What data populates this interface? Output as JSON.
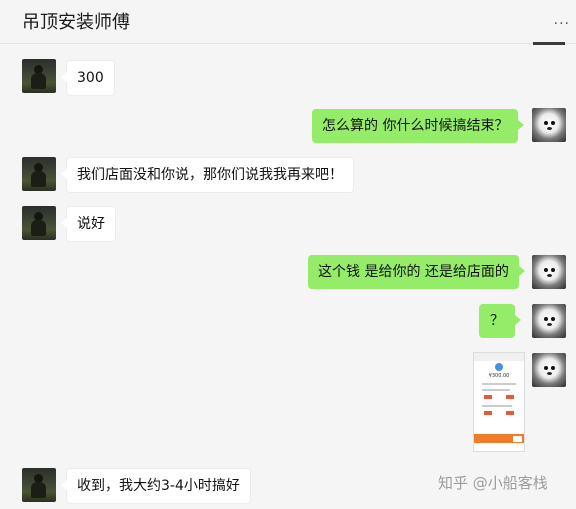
{
  "header": {
    "title": "吊顶安装师傅",
    "more": "..."
  },
  "messages": [
    {
      "side": "left",
      "text": "300"
    },
    {
      "side": "right",
      "text": "怎么算的  你什么时候搞结束？"
    },
    {
      "side": "left",
      "text": "我们店面没和你说，那你们说我我再来吧！"
    },
    {
      "side": "left",
      "text": "说好"
    },
    {
      "side": "right",
      "text": "这个钱 是给你的 还是给店面的"
    },
    {
      "side": "right",
      "text": "？"
    },
    {
      "side": "right",
      "type": "image",
      "amount": "¥300.00"
    },
    {
      "side": "left",
      "text": "收到，我大约3-4小时搞好"
    }
  ],
  "watermark": "知乎 @小船客栈"
}
